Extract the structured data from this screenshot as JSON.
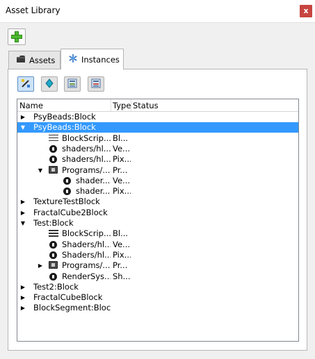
{
  "window": {
    "title": "Asset Library",
    "close_label": "x"
  },
  "tabs": [
    {
      "label": "Assets"
    },
    {
      "label": "Instances"
    }
  ],
  "tree": {
    "columns": {
      "name": "Name",
      "type": "Type",
      "status": "Status"
    },
    "rows": [
      {
        "name": "PsyBeads:Block",
        "type": "",
        "depth": 0,
        "arrow": "collapsed",
        "icon": ""
      },
      {
        "name": "PsyBeads:Block",
        "type": "",
        "depth": 0,
        "arrow": "expanded",
        "icon": "",
        "selected": true
      },
      {
        "name": "BlockScrip...",
        "type": "Bl...",
        "depth": 1,
        "arrow": "",
        "icon": "lines"
      },
      {
        "name": "shaders/hl...",
        "type": "Ve...",
        "depth": 1,
        "arrow": "",
        "icon": "dot"
      },
      {
        "name": "shaders/hl...",
        "type": "Pix...",
        "depth": 1,
        "arrow": "",
        "icon": "dot"
      },
      {
        "name": "Programs/...",
        "type": "Pr...",
        "depth": 1,
        "arrow": "expanded",
        "icon": "cpu"
      },
      {
        "name": "shader...",
        "type": "Ve...",
        "depth": 2,
        "arrow": "",
        "icon": "dot"
      },
      {
        "name": "shader...",
        "type": "Pix...",
        "depth": 2,
        "arrow": "",
        "icon": "dot"
      },
      {
        "name": "TextureTestBlock",
        "type": "",
        "depth": 0,
        "arrow": "collapsed",
        "icon": ""
      },
      {
        "name": "FractalCube2Block",
        "type": "",
        "depth": 0,
        "arrow": "collapsed",
        "icon": ""
      },
      {
        "name": "Test:Block",
        "type": "",
        "depth": 0,
        "arrow": "expanded",
        "icon": ""
      },
      {
        "name": "BlockScrip...",
        "type": "Bl...",
        "depth": 1,
        "arrow": "",
        "icon": "lines"
      },
      {
        "name": "Shaders/hl...",
        "type": "Ve...",
        "depth": 1,
        "arrow": "",
        "icon": "dot"
      },
      {
        "name": "Shaders/hl...",
        "type": "Pix...",
        "depth": 1,
        "arrow": "",
        "icon": "dot"
      },
      {
        "name": "Programs/...",
        "type": "Pr...",
        "depth": 1,
        "arrow": "collapsed",
        "icon": "cpu"
      },
      {
        "name": "RenderSys...",
        "type": "Sh...",
        "depth": 1,
        "arrow": "",
        "icon": "dot"
      },
      {
        "name": "Test2:Block",
        "type": "",
        "depth": 0,
        "arrow": "collapsed",
        "icon": ""
      },
      {
        "name": "FractalCubeBlock",
        "type": "",
        "depth": 0,
        "arrow": "collapsed",
        "icon": ""
      },
      {
        "name": "BlockSegment:Block",
        "type": "",
        "depth": 0,
        "arrow": "collapsed",
        "icon": ""
      }
    ]
  }
}
